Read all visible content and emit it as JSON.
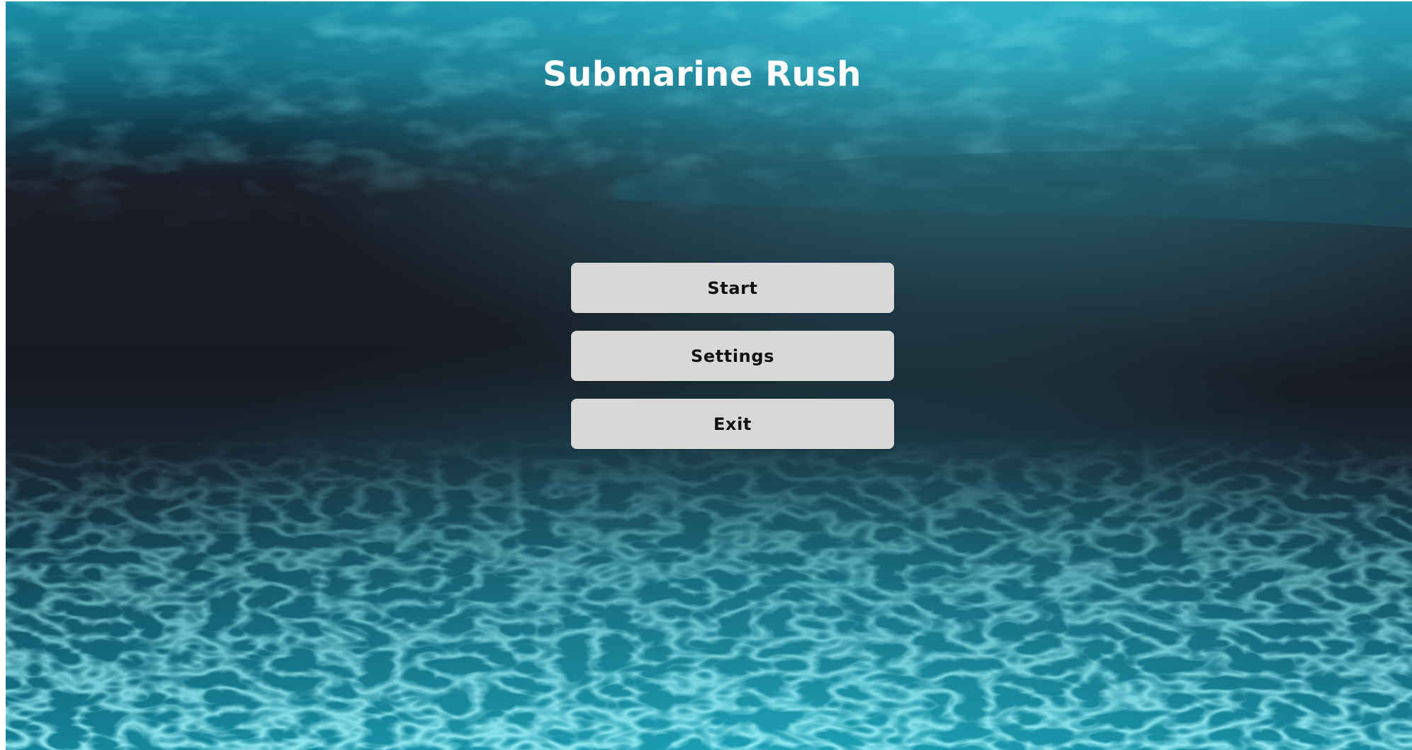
{
  "game": {
    "title": "Submarine Rush"
  },
  "menu": {
    "buttons": [
      {
        "label": "Start"
      },
      {
        "label": "Settings"
      },
      {
        "label": "Exit"
      }
    ]
  },
  "colors": {
    "button_bg": "#d8d8d8",
    "button_text": "#111111",
    "title_text": "#ffffff",
    "water_dark": "#191b25",
    "water_light": "#2ec9dd"
  }
}
